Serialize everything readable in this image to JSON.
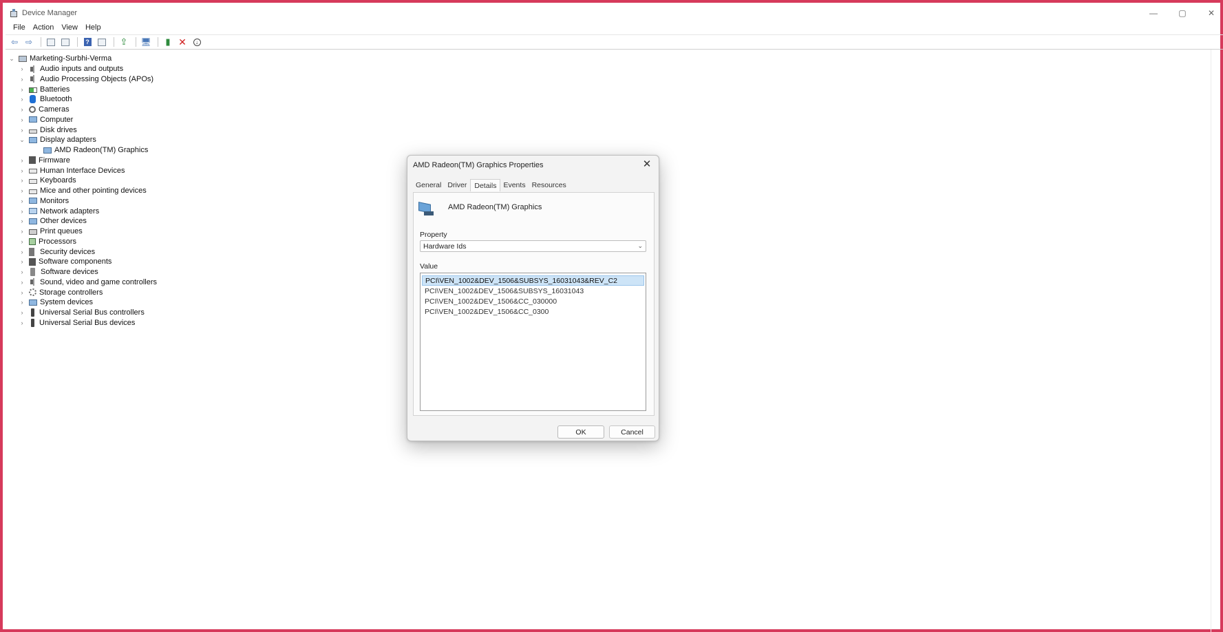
{
  "window": {
    "title": "Device Manager",
    "controls": [
      "—",
      "▢",
      "✕"
    ]
  },
  "menu": [
    "File",
    "Action",
    "View",
    "Help"
  ],
  "toolbar": {
    "icons": [
      "back-arrow-icon",
      "forward-arrow-icon",
      "properties-icon",
      "driver-icon",
      "help-icon",
      "view-icon",
      "update-driver-icon",
      "scan-hardware-icon",
      "enable-device-icon",
      "uninstall-icon",
      "download-icon"
    ]
  },
  "tree": {
    "root": "Marketing-Surbhi-Verma",
    "items": [
      {
        "label": "Audio inputs and outputs",
        "icon": "speaker",
        "expanded": false
      },
      {
        "label": "Audio Processing Objects (APOs)",
        "icon": "speaker",
        "expanded": false
      },
      {
        "label": "Batteries",
        "icon": "battery",
        "expanded": false
      },
      {
        "label": "Bluetooth",
        "icon": "bluetooth",
        "expanded": false
      },
      {
        "label": "Cameras",
        "icon": "camera",
        "expanded": false
      },
      {
        "label": "Computer",
        "icon": "monitor",
        "expanded": false
      },
      {
        "label": "Disk drives",
        "icon": "disk",
        "expanded": false
      },
      {
        "label": "Display adapters",
        "icon": "monitor",
        "expanded": true
      },
      {
        "label": "AMD Radeon(TM) Graphics",
        "icon": "monitor",
        "child": true
      },
      {
        "label": "Firmware",
        "icon": "chip",
        "expanded": false
      },
      {
        "label": "Human Interface Devices",
        "icon": "keyboard",
        "expanded": false
      },
      {
        "label": "Keyboards",
        "icon": "keyboard",
        "expanded": false
      },
      {
        "label": "Mice and other pointing devices",
        "icon": "keyboard",
        "expanded": false
      },
      {
        "label": "Monitors",
        "icon": "monitor",
        "expanded": false
      },
      {
        "label": "Network adapters",
        "icon": "network",
        "expanded": false
      },
      {
        "label": "Other devices",
        "icon": "monitor",
        "expanded": false
      },
      {
        "label": "Print queues",
        "icon": "printer",
        "expanded": false
      },
      {
        "label": "Processors",
        "icon": "cpu",
        "expanded": false
      },
      {
        "label": "Security devices",
        "icon": "key",
        "expanded": false
      },
      {
        "label": "Software components",
        "icon": "chip",
        "expanded": false
      },
      {
        "label": "Software devices",
        "icon": "phone",
        "expanded": false
      },
      {
        "label": "Sound, video and game controllers",
        "icon": "speaker",
        "expanded": false
      },
      {
        "label": "Storage controllers",
        "icon": "gear",
        "expanded": false
      },
      {
        "label": "System devices",
        "icon": "monitor",
        "expanded": false
      },
      {
        "label": "Universal Serial Bus controllers",
        "icon": "usb",
        "expanded": false
      },
      {
        "label": "Universal Serial Bus devices",
        "icon": "usb",
        "expanded": false
      }
    ]
  },
  "dialog": {
    "title": "AMD Radeon(TM) Graphics Properties",
    "close": "✕",
    "tabs": [
      "General",
      "Driver",
      "Details",
      "Events",
      "Resources"
    ],
    "active_tab": "Details",
    "device_name": "AMD Radeon(TM) Graphics",
    "property_label": "Property",
    "property_value": "Hardware Ids",
    "value_label": "Value",
    "values": [
      "PCI\\VEN_1002&DEV_1506&SUBSYS_16031043&REV_C2",
      "PCI\\VEN_1002&DEV_1506&SUBSYS_16031043",
      "PCI\\VEN_1002&DEV_1506&CC_030000",
      "PCI\\VEN_1002&DEV_1506&CC_0300"
    ],
    "ok_label": "OK",
    "cancel_label": "Cancel"
  },
  "colors": {
    "frame_border": "#d63a5b",
    "selection": "#cde4f7"
  }
}
